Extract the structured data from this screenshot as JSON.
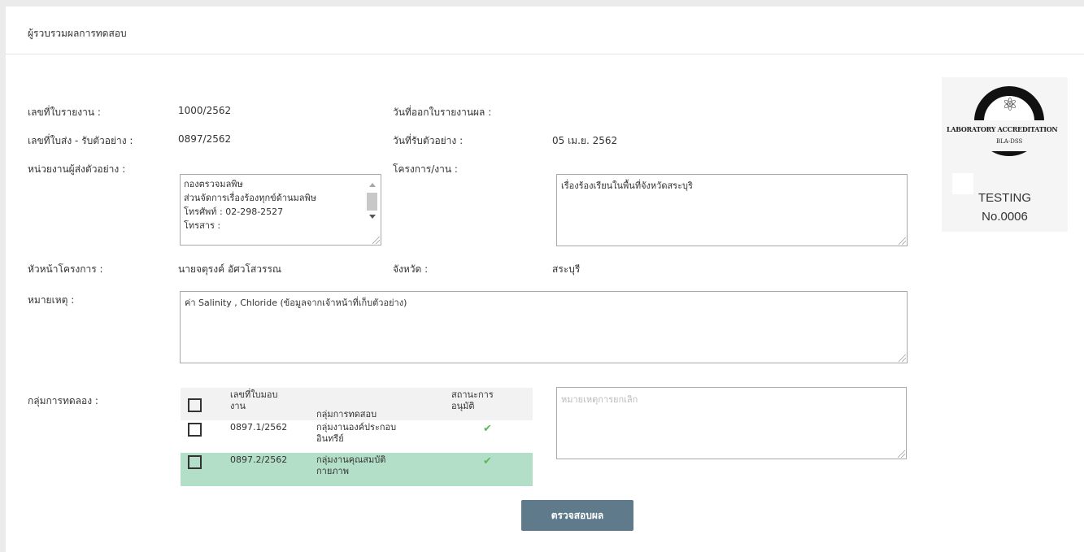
{
  "panel": {
    "title": "ผู้รวบรวมผลการทดสอบ"
  },
  "report": {
    "report_no_label": "เลขที่ใบรายงาน :",
    "report_no": "1000/2562",
    "issue_date_label": "วันที่ออกใบรายงานผล :",
    "issue_date": "",
    "sending_no_label": "เลขที่ใบส่ง - รับตัวอย่าง :",
    "sending_no": "0897/2562",
    "received_date_label": "วันที่รับตัวอย่าง :",
    "received_date": "05 เม.ย. 2562",
    "sender_unit_label": "หน่วยงานผู้ส่งตัวอย่าง :",
    "sender_unit_lines": [
      "กองตรวจมลพิษ",
      "ส่วนจัดการเรื่องร้องทุกข์ด้านมลพิษ",
      "โทรศัพท์ : 02-298-2527",
      "โทรสาร :"
    ],
    "project_label": "โครงการ/งาน :",
    "project": "เรื่องร้องเรียนในพื้นที่จังหวัดสระบุริ",
    "head_label": "หัวหน้าโครงการ :",
    "head": "นายจตุรงค์ อัศวโสวรรณ",
    "province_label": "จังหวัด :",
    "province": "สระบุรี",
    "remark_label": "หมายเหตุ :",
    "remark": "ค่า Salinity , Chloride (ข้อมูลจากเจ้าหน้าที่เก็บตัวอย่าง)",
    "group_label": "กลุ่มการทดลอง :"
  },
  "test_table": {
    "headers": {
      "assign_no": [
        "เลขที่ใบมอบ",
        "งาน"
      ],
      "group": "กลุ่มการทดสอบ",
      "status": [
        "สถานะการ",
        "อนุมัติ"
      ]
    },
    "rows": [
      {
        "assign_no": "0897.1/2562",
        "group": [
          "กลุ่มงานองค์ประกอบ",
          "อินทรีย์"
        ],
        "approved": true,
        "selected": false
      },
      {
        "assign_no": "0897.2/2562",
        "group": [
          "กลุ่มงานคุณสมบัติ",
          "กายภาพ"
        ],
        "approved": true,
        "selected": true
      }
    ]
  },
  "cancel_remark": {
    "placeholder": "หมายเหตุการยกเลิก",
    "value": ""
  },
  "check_button_label": "ตรวจสอบผล",
  "logo": {
    "line1": "LABORATORY ACCREDITATION",
    "line2": "BLA-DSS",
    "testing": "TESTING",
    "number": "No.0006",
    "icon": "atom-icon"
  },
  "colors": {
    "button": "#5f7a8a",
    "selected_row": "#b3dfc9",
    "check": "#5cb85c"
  }
}
